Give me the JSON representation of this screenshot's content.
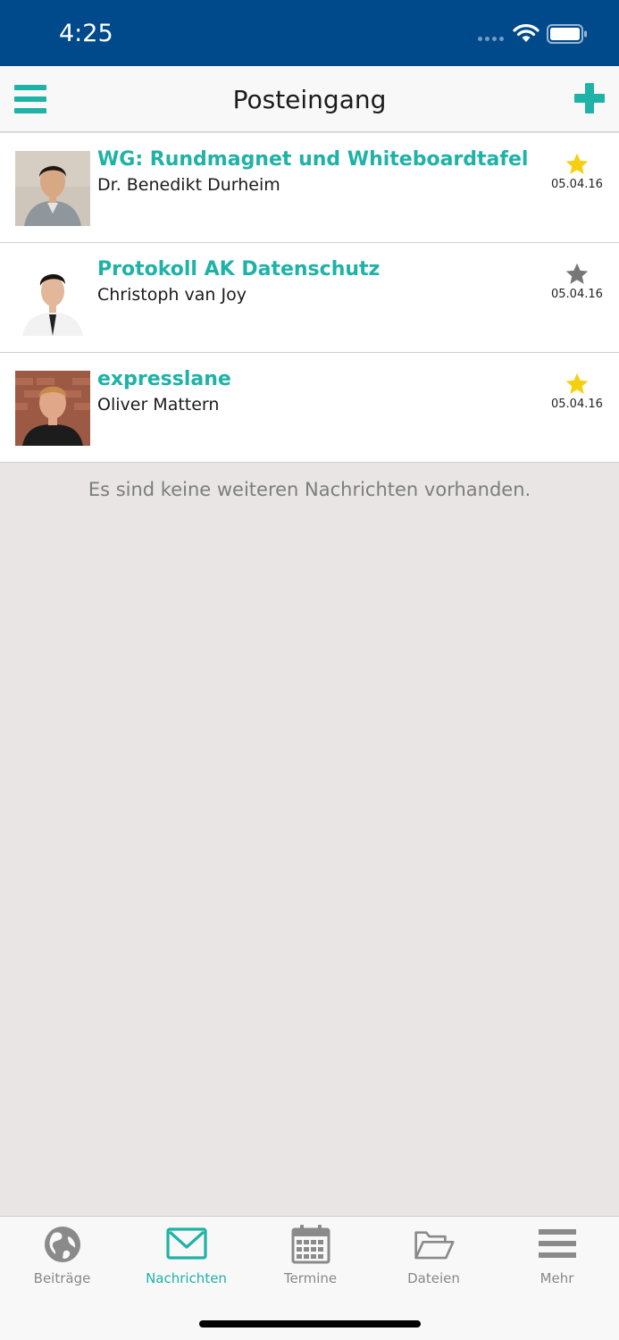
{
  "status_bar": {
    "time": "4:25"
  },
  "nav": {
    "title": "Posteingang"
  },
  "messages": [
    {
      "subject": "WG: Rundmagnet und Whiteboardtafel",
      "sender": "Dr. Benedikt Durheim",
      "date": "05.04.16",
      "starred": true
    },
    {
      "subject": "Protokoll AK Datenschutz",
      "sender": "Christoph van Joy",
      "date": "05.04.16",
      "starred": false
    },
    {
      "subject": "expresslane",
      "sender": "Oliver Mattern",
      "date": "05.04.16",
      "starred": true
    }
  ],
  "empty_message": "Es sind keine weiteren Nachrichten vorhanden.",
  "tabs": [
    {
      "label": "Beiträge",
      "icon": "globe-icon",
      "active": false
    },
    {
      "label": "Nachrichten",
      "icon": "envelope-icon",
      "active": true
    },
    {
      "label": "Termine",
      "icon": "calendar-icon",
      "active": false
    },
    {
      "label": "Dateien",
      "icon": "folder-icon",
      "active": false
    },
    {
      "label": "Mehr",
      "icon": "menu-icon",
      "active": false
    }
  ],
  "colors": {
    "status_bar": "#004a8c",
    "accent": "#1fb2a6",
    "star_active": "#f6cf10",
    "star_inactive": "#777777",
    "background": "#e8e5e4"
  }
}
